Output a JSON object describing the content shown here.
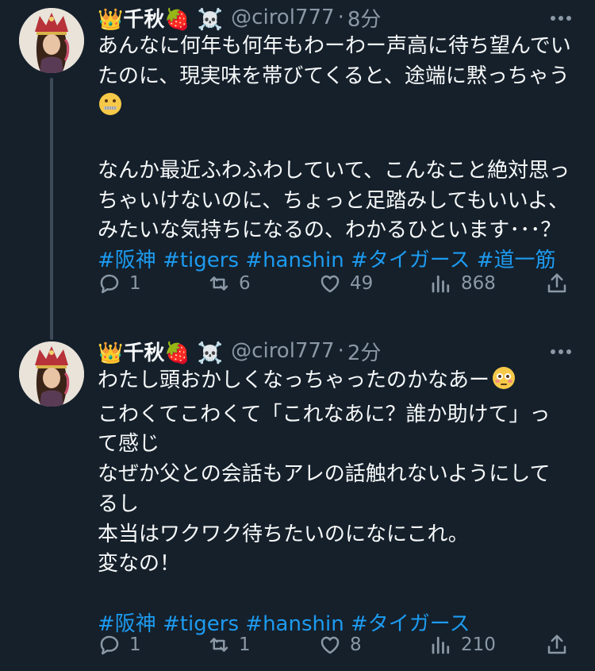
{
  "tweets": [
    {
      "name": "👑千秋🍓 ☠️",
      "handle": "@cirol777",
      "time": "8分",
      "lines": [
        "あんなに何年も何年もわーわー声高に待ち望んでい",
        "たのに、現実味を帯びてくると、途端に黙っちゃう",
        "",
        "",
        "なんか最近ふわふわしていて、こんなこと絶対思っ",
        "ちゃいけないのに、ちょっと足踏みしてもいいよ、",
        "みたいな気持ちになるの、わかるひといます･･･？"
      ],
      "emoji_after_line2": "zipper-mouth-face",
      "hashtags": [
        "#阪神",
        "#tigers",
        "#hanshin",
        "#タイガース",
        "#道一筋"
      ],
      "replies": "1",
      "reposts": "6",
      "likes": "49",
      "views": "868"
    },
    {
      "name": "👑千秋🍓 ☠️",
      "handle": "@cirol777",
      "time": "2分",
      "lines": [
        "わたし頭おかしくなっちゃったのかなあー",
        "こわくてこわくて「これなあに？誰か助けて」っ",
        "て感じ",
        "なぜか父との会話もアレの話触れないようにして",
        "るし",
        "本当はワクワク待ちたいのになにこれ。",
        "変なの！",
        ""
      ],
      "emoji_after_line1": "flushed-face",
      "hashtags": [
        "#阪神",
        "#tigers",
        "#hanshin",
        "#タイガース"
      ],
      "replies": "1",
      "reposts": "1",
      "likes": "8",
      "views": "210"
    }
  ],
  "icons": [
    "reply-icon",
    "repost-icon",
    "like-icon",
    "views-icon",
    "share-icon",
    "more-icon"
  ],
  "colors": {
    "background": "#15202b",
    "text": "#f7f9f9",
    "muted": "#8b98a5",
    "hashtag": "#1d9bf0",
    "thread_line": "#3d4a57"
  }
}
